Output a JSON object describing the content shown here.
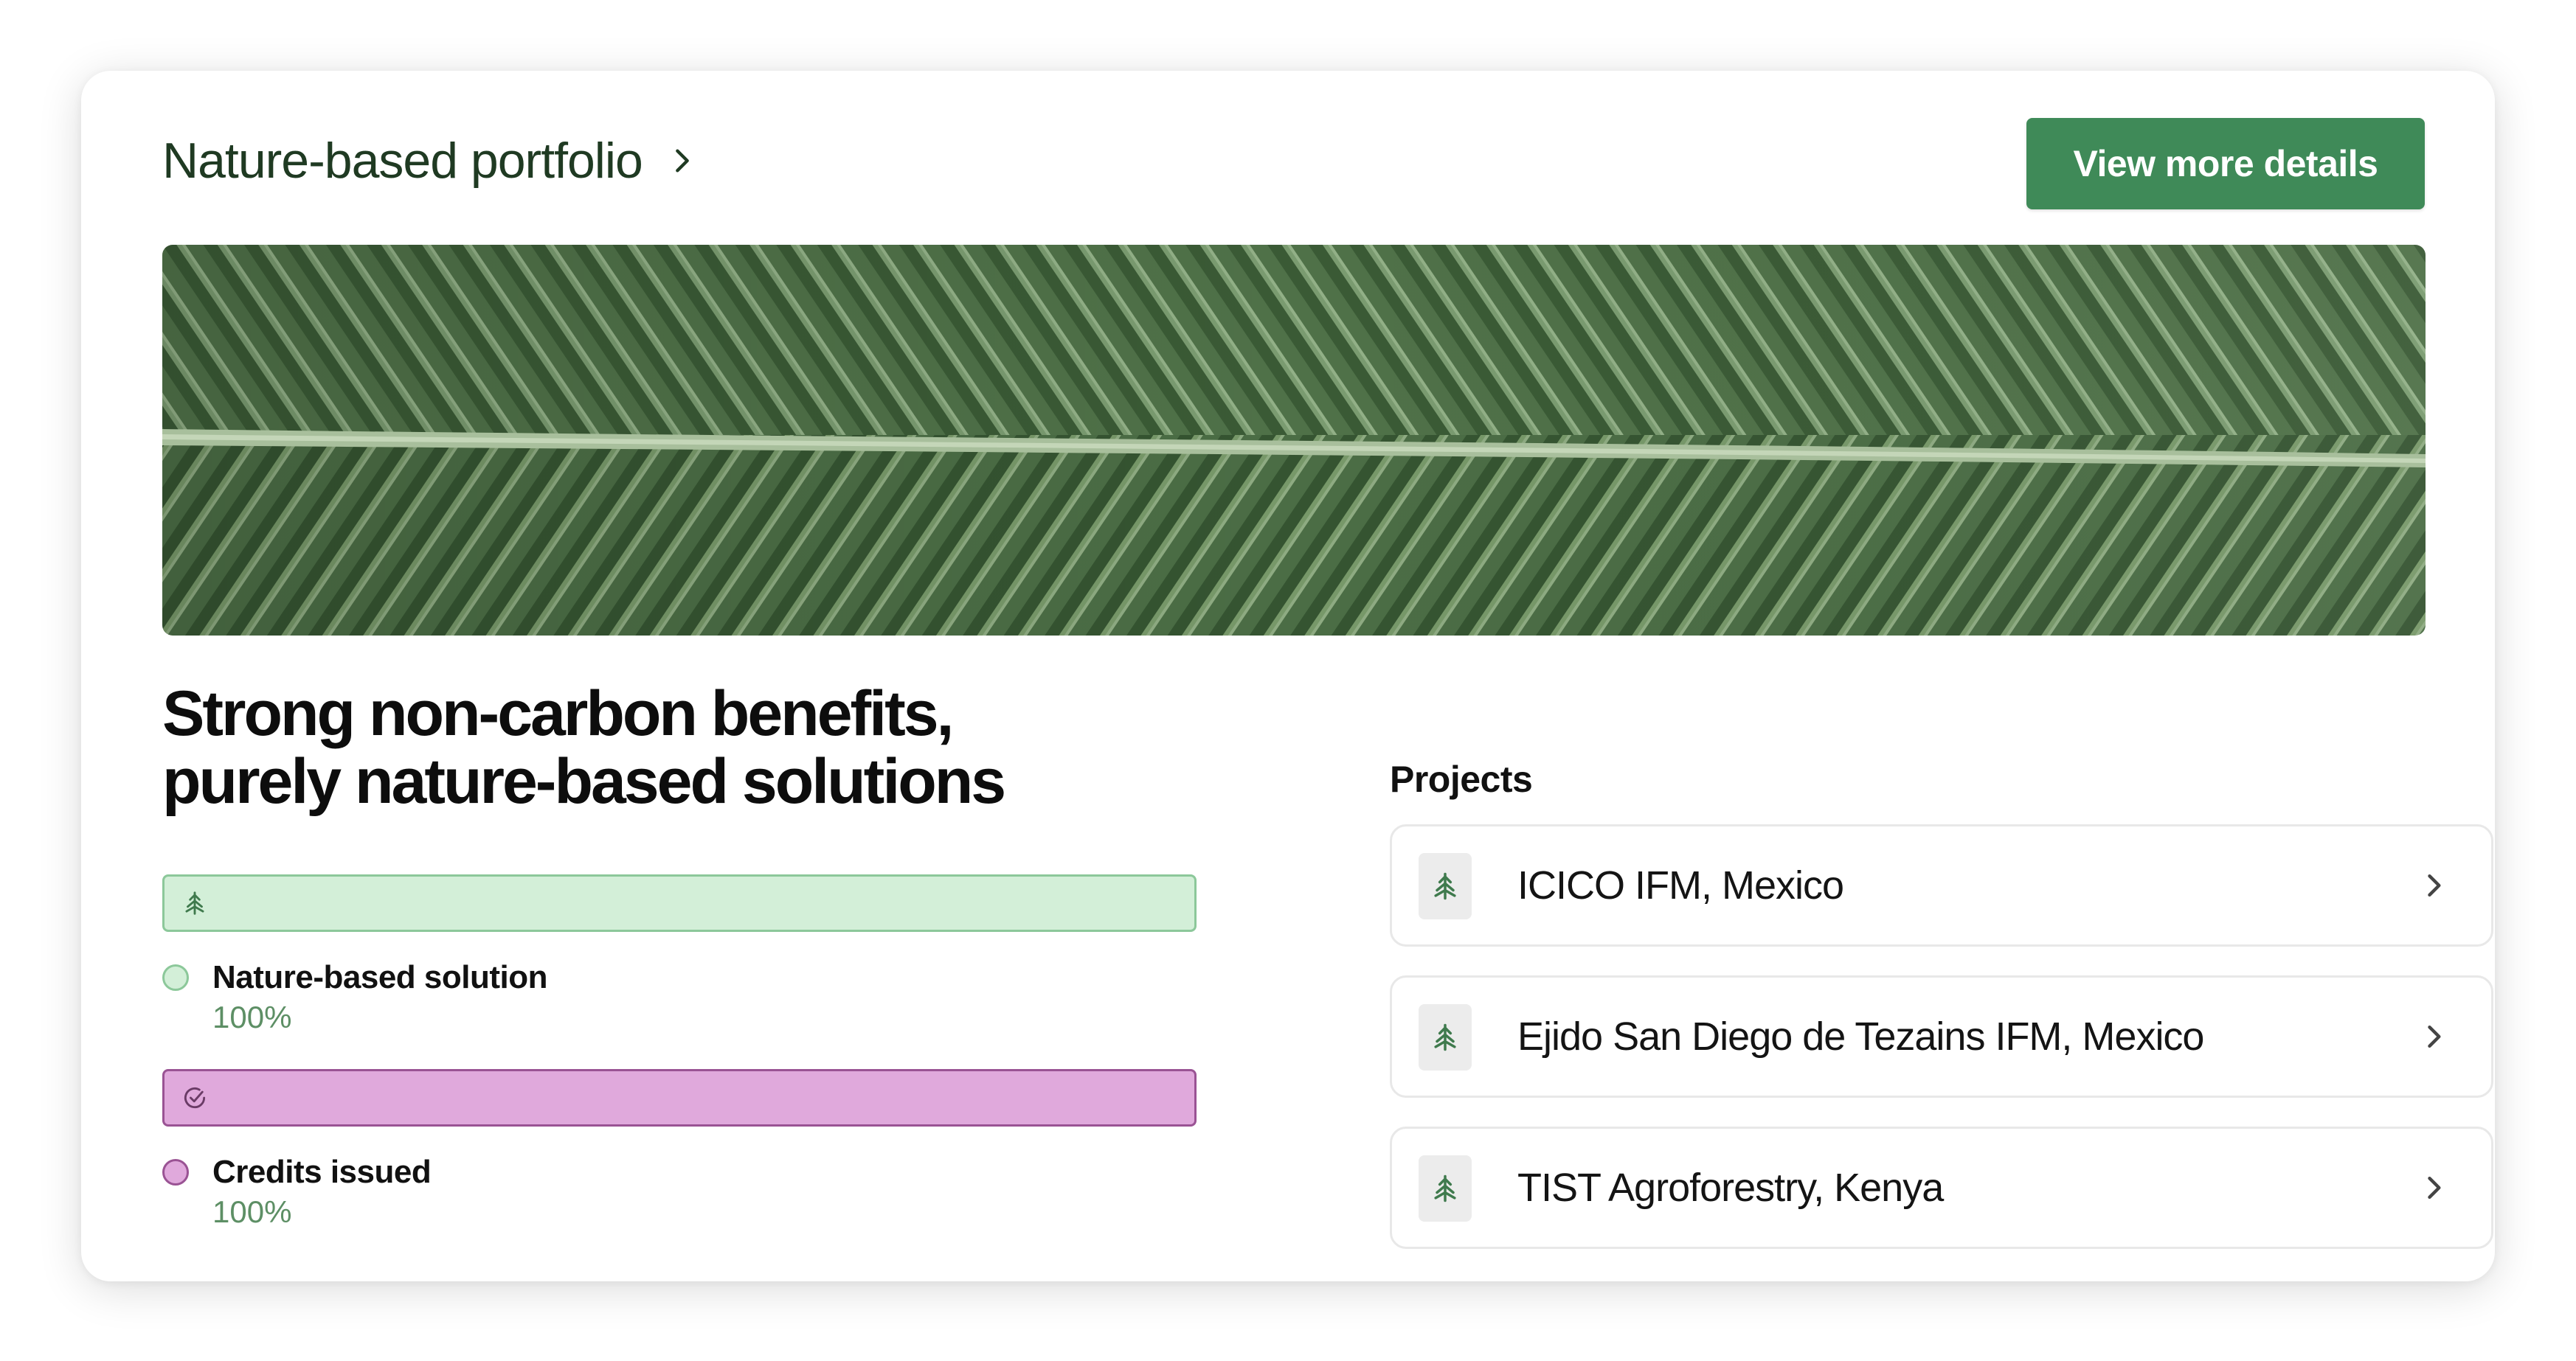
{
  "header": {
    "title": "Nature-based portfolio",
    "button_label": "View more details"
  },
  "colors": {
    "brand_green": "#3f8a58",
    "nature_bar": "#d3efd8",
    "credits_bar": "#e0a9dc",
    "percent_text": "#5d8f65"
  },
  "summary": {
    "headline_line1": "Strong non-carbon benefits,",
    "headline_line2": "purely nature-based solutions"
  },
  "breakdown": [
    {
      "icon": "tree-icon",
      "label": "Nature-based solution",
      "percent_label": "100%",
      "fill_fraction": 1.0
    },
    {
      "icon": "check-circle-icon",
      "label": "Credits issued",
      "percent_label": "100%",
      "fill_fraction": 1.0
    }
  ],
  "projects": {
    "title": "Projects",
    "items": [
      {
        "icon": "tree-icon",
        "name": "ICICO IFM, Mexico"
      },
      {
        "icon": "tree-icon",
        "name": "Ejido San Diego de Tezains IFM, Mexico"
      },
      {
        "icon": "tree-icon",
        "name": "TIST Agroforestry, Kenya"
      }
    ]
  }
}
